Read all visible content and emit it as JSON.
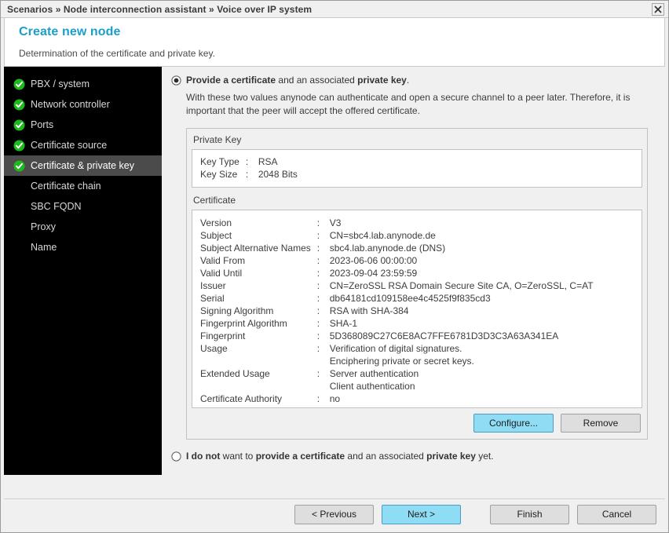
{
  "titlebar": {
    "breadcrumb": "Scenarios » Node interconnection assistant » Voice over IP system",
    "close_icon": "close-icon"
  },
  "header": {
    "title": "Create new node",
    "subtitle": "Determination of the certificate and private key.",
    "title_color": "#1a9fc9"
  },
  "sidebar": {
    "background": "#000000",
    "selected_background": "#4b4b4b",
    "check_color": "#1fb81f",
    "items": [
      {
        "label": "PBX / system",
        "completed": true,
        "selected": false
      },
      {
        "label": "Network controller",
        "completed": true,
        "selected": false
      },
      {
        "label": "Ports",
        "completed": true,
        "selected": false
      },
      {
        "label": "Certificate source",
        "completed": true,
        "selected": false
      },
      {
        "label": "Certificate & private key",
        "completed": true,
        "selected": true
      },
      {
        "label": "Certificate chain",
        "completed": false,
        "selected": false
      },
      {
        "label": "SBC FQDN",
        "completed": false,
        "selected": false
      },
      {
        "label": "Proxy",
        "completed": false,
        "selected": false
      },
      {
        "label": "Name",
        "completed": false,
        "selected": false
      }
    ]
  },
  "main": {
    "option_provide": {
      "selected": true,
      "text_part1": "Provide a certificate",
      "text_part2": " and an associated ",
      "text_part3": "private key",
      "text_part4": ".",
      "description": "With these two values anynode can authenticate and open a secure channel to a peer later. Therefore, it is important that the peer will accept the offered certificate."
    },
    "option_decline": {
      "selected": false,
      "text_part1": "I do not",
      "text_part2": " want to ",
      "text_part3": "provide a certificate",
      "text_part4": " and an associated ",
      "text_part5": "private key",
      "text_part6": " yet."
    },
    "private_key": {
      "label": "Private Key",
      "rows": [
        {
          "key": "Key Type",
          "values": [
            "RSA"
          ]
        },
        {
          "key": "Key Size",
          "values": [
            "2048 Bits"
          ]
        }
      ]
    },
    "certificate": {
      "label": "Certificate",
      "rows": [
        {
          "key": "Version",
          "values": [
            "V3"
          ]
        },
        {
          "key": "Subject",
          "values": [
            "CN=sbc4.lab.anynode.de"
          ]
        },
        {
          "key": "Subject Alternative Names",
          "values": [
            "sbc4.lab.anynode.de (DNS)"
          ]
        },
        {
          "key": "Valid From",
          "values": [
            "2023-06-06 00:00:00"
          ]
        },
        {
          "key": "Valid Until",
          "values": [
            "2023-09-04 23:59:59"
          ]
        },
        {
          "key": "Issuer",
          "values": [
            "CN=ZeroSSL RSA Domain Secure Site CA, O=ZeroSSL, C=AT"
          ]
        },
        {
          "key": "Serial",
          "values": [
            "db64181cd109158ee4c4525f9f835cd3"
          ]
        },
        {
          "key": "Signing Algorithm",
          "values": [
            "RSA with SHA-384"
          ]
        },
        {
          "key": "Fingerprint Algorithm",
          "values": [
            "SHA-1"
          ]
        },
        {
          "key": "Fingerprint",
          "values": [
            "5D368089C27C6E8AC7FFE6781D3D3C3A63A341EA"
          ]
        },
        {
          "key": "Usage",
          "values": [
            "Verification of digital signatures.",
            "Enciphering private or secret keys."
          ]
        },
        {
          "key": "Extended Usage",
          "values": [
            "Server authentication",
            "Client authentication"
          ]
        },
        {
          "key": "Certificate Authority",
          "values": [
            "no"
          ]
        }
      ],
      "configure_label": "Configure...",
      "remove_label": "Remove"
    }
  },
  "footer": {
    "previous_label": "< Previous",
    "next_label": "Next >",
    "finish_label": "Finish",
    "cancel_label": "Cancel",
    "primary_color": "#8fddf5"
  }
}
